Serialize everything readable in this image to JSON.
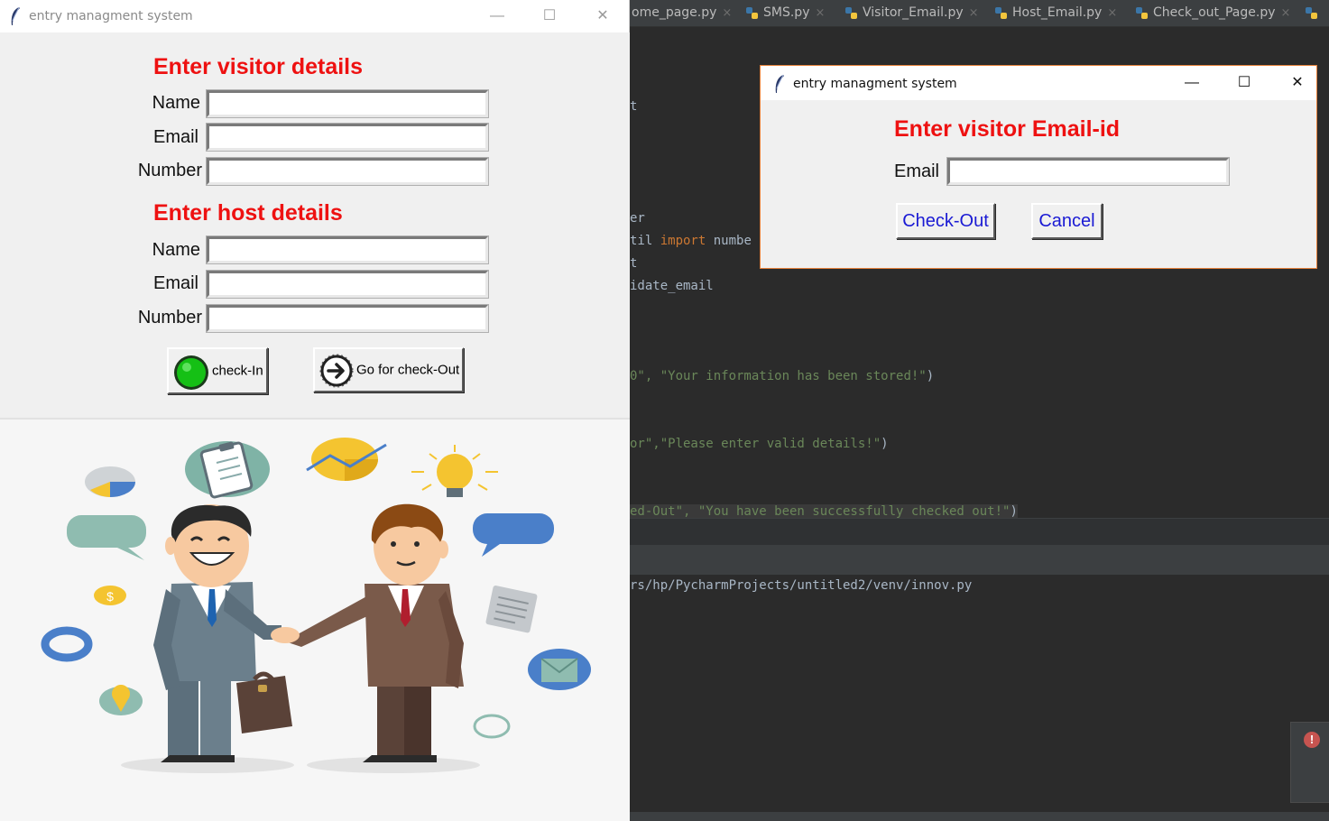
{
  "main_window": {
    "title": "entry managment system",
    "controls": {
      "minimize": "—",
      "maximize": "☐",
      "close": "✕"
    },
    "visitor_heading": "Enter visitor details",
    "visitor_fields": [
      {
        "label": "Name",
        "value": ""
      },
      {
        "label": "Email",
        "value": ""
      },
      {
        "label": "Number",
        "value": ""
      }
    ],
    "host_heading": "Enter host details",
    "host_fields": [
      {
        "label": "Name",
        "value": ""
      },
      {
        "label": "Email",
        "value": ""
      },
      {
        "label": "Number",
        "value": ""
      }
    ],
    "checkin_button": "check-In",
    "checkout_button": "Go for check-Out",
    "illustration_icon": "business-handshake-illustration"
  },
  "dialog": {
    "title": "entry managment system",
    "controls": {
      "minimize": "—",
      "maximize": "☐",
      "close": "✕"
    },
    "heading": "Enter visitor Email-id",
    "email_label": "Email",
    "email_value": "",
    "checkout_button": "Check-Out",
    "cancel_button": "Cancel"
  },
  "ide": {
    "tabs": [
      {
        "label": "ome_page.py"
      },
      {
        "label": "SMS.py"
      },
      {
        "label": "Visitor_Email.py"
      },
      {
        "label": "Host_Email.py"
      },
      {
        "label": "Check_out_Page.py"
      }
    ],
    "tab_close": "×",
    "code_lines": {
      "l1": "t",
      "l2": "er",
      "l3a": "til ",
      "l3b": "import",
      "l3c": " numbe",
      "l4": "t",
      "l5": "idate_email",
      "l6a": "0\", ",
      "l6b": "\"Your information has been stored!\"",
      "l6c": ")",
      "l7a": "or\",",
      "l7b": "\"Please enter valid details!\"",
      "l7c": ")",
      "l8a": "ed-Out\", ",
      "l8b": "\"You have been successfully checked out!\"",
      "l8c": ")"
    },
    "console_line": "rs/hp/PycharmProjects/untitled2/venv/innov.py",
    "notification_icon": "error-icon",
    "notification_text": "!"
  },
  "colors": {
    "heading_red": "#ee1111",
    "dialog_button_blue": "#1a1ad4",
    "ide_background": "#2b2b2b",
    "string_green": "#6a8759",
    "keyword_orange": "#cc7832"
  }
}
